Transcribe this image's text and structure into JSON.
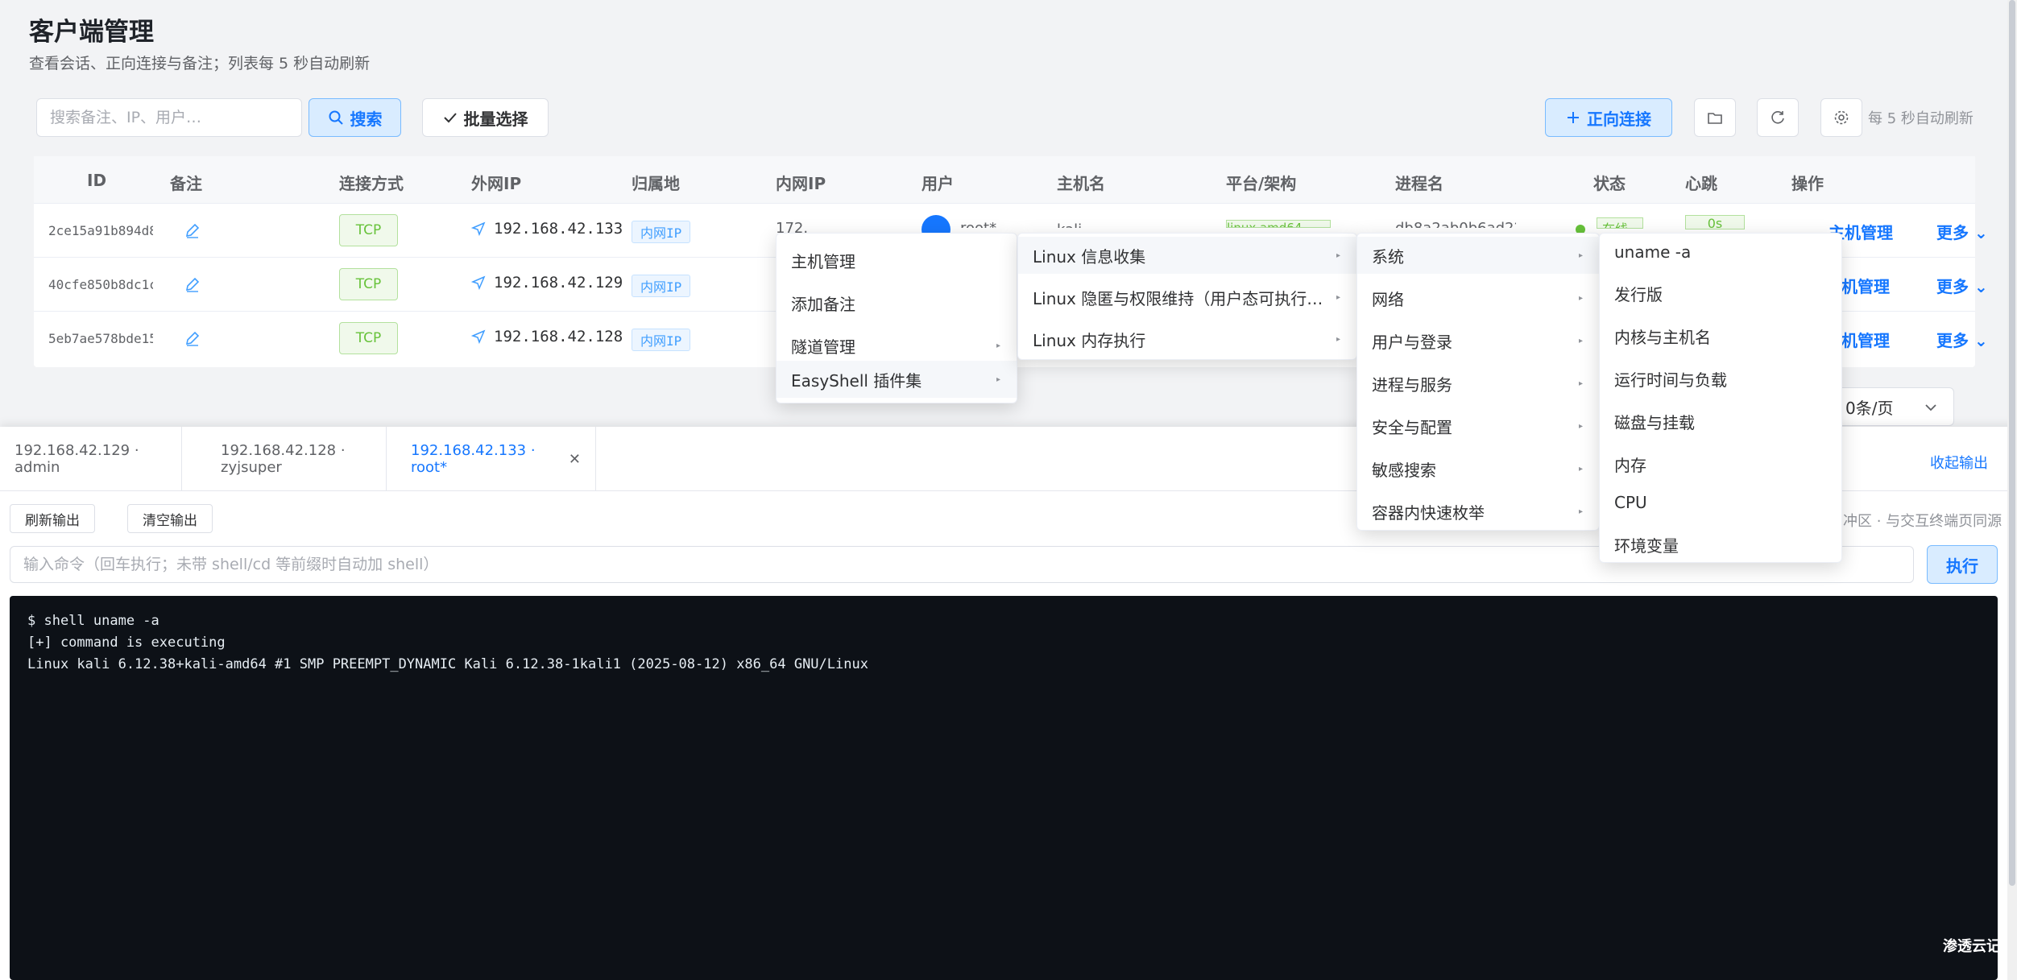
{
  "page": {
    "title": "客户端管理",
    "subtitle": "查看会话、正向连接与备注；列表每 5 秒自动刷新"
  },
  "toolbar": {
    "search_placeholder": "搜索备注、IP、用户…",
    "search_label": "搜索",
    "batch_label": "批量选择",
    "connect_label": "正向连接",
    "auto_refresh": "每 5 秒自动刷新"
  },
  "table": {
    "headers": [
      "ID",
      "备注",
      "连接方式",
      "外网IP",
      "归属地",
      "内网IP",
      "用户",
      "主机名",
      "平台/架构",
      "进程名",
      "状态",
      "心跳",
      "操作"
    ],
    "rows": [
      {
        "id": "2ce15a91b894d8",
        "conn": "TCP",
        "ext_ip": "192.168.42.133",
        "location": "内网IP",
        "op_main": "主机管理",
        "op_more": "更多"
      },
      {
        "id": "40cfe850b8dc1c",
        "conn": "TCP",
        "ext_ip": "192.168.42.129",
        "location": "内网IP",
        "op_main": "机管理",
        "op_more": "更多"
      },
      {
        "id": "5eb7ae578bde15",
        "conn": "TCP",
        "ext_ip": "192.168.42.128",
        "location": "内网IP",
        "op_main": "机管理",
        "op_more": "更多"
      }
    ],
    "row0_partial": {
      "inner_ip": "172.17.0.1",
      "user": "root*",
      "host": "kali",
      "platform": "linux amd64",
      "process": "db8a2ab0b6ad22",
      "status": "在线",
      "heartbeat": "0s"
    }
  },
  "pager": {
    "page_size": "0条/页"
  },
  "context_menu": {
    "level1": [
      {
        "label": "主机管理",
        "submenu": false
      },
      {
        "label": "添加备注",
        "submenu": false
      },
      {
        "label": "隧道管理",
        "submenu": true
      },
      {
        "label": "EasyShell 插件集",
        "submenu": true
      }
    ],
    "level2": [
      {
        "label": "Linux 信息收集",
        "submenu": true
      },
      {
        "label": "Linux 隐匿与权限维持（用户态可执行…",
        "submenu": true
      },
      {
        "label": "Linux 内存执行",
        "submenu": true
      }
    ],
    "level3": [
      {
        "label": "系统",
        "submenu": true
      },
      {
        "label": "网络",
        "submenu": true
      },
      {
        "label": "用户与登录",
        "submenu": true
      },
      {
        "label": "进程与服务",
        "submenu": true
      },
      {
        "label": "安全与配置",
        "submenu": true
      },
      {
        "label": "敏感搜索",
        "submenu": true
      },
      {
        "label": "容器内快速枚举",
        "submenu": true
      }
    ],
    "level4": [
      {
        "label": "uname -a"
      },
      {
        "label": "发行版"
      },
      {
        "label": "内核与主机名"
      },
      {
        "label": "运行时间与负载"
      },
      {
        "label": "磁盘与挂载"
      },
      {
        "label": "内存"
      },
      {
        "label": "CPU"
      },
      {
        "label": "环境变量"
      }
    ]
  },
  "sessions": {
    "tabs": [
      {
        "label": "192.168.42.129 · admin",
        "active": false
      },
      {
        "label": "192.168.42.128 · zyjsuper",
        "active": false
      },
      {
        "label": "192.168.42.133 · root*",
        "active": true
      }
    ],
    "collapse_label": "收起输出",
    "refresh_output": "刷新输出",
    "clear_output": "清空输出",
    "hint": "冲区 · 与交互终端页同源",
    "cmd_placeholder": "输入命令（回车执行；未带 shell/cd 等前缀时自动加 shell）",
    "exec_label": "执行"
  },
  "terminal": {
    "lines": [
      "$ shell uname -a",
      "[+] command is executing",
      "Linux kali 6.12.38+kali-amd64 #1 SMP PREEMPT_DYNAMIC Kali 6.12.38-1kali1 (2025-08-12) x86_64 GNU/Linux"
    ],
    "watermark": "渗透云记"
  },
  "colors": {
    "accent": "#1677ff",
    "success": "#67c23a",
    "terminal_bg": "#0d1117"
  }
}
